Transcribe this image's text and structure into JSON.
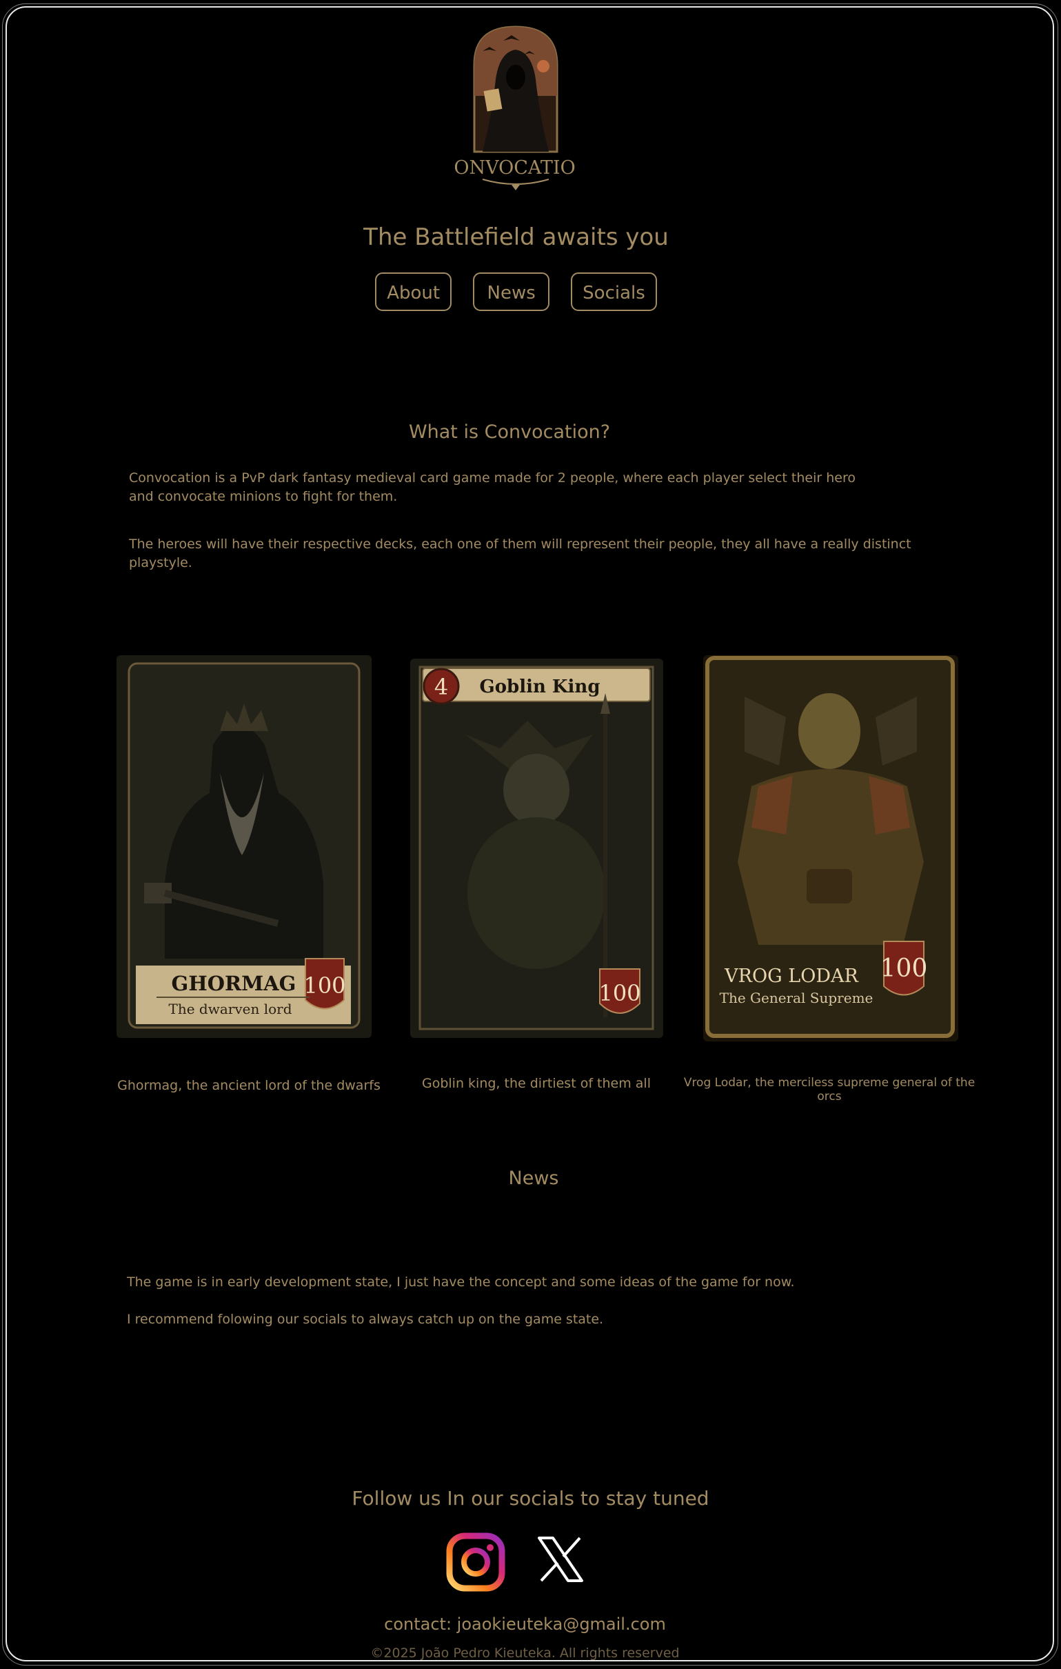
{
  "logo": {
    "name": "convocation-logo",
    "text": "CONVOCATION"
  },
  "hero": {
    "tagline": "The Battlefield awaits you"
  },
  "nav": {
    "about": "About",
    "news": "News",
    "socials": "Socials"
  },
  "about": {
    "title": "What is Convocation?",
    "p1": "Convocation is a PvP dark fantasy medieval card game made for 2 people, where each player select their hero and convocate minions to fight for them.",
    "p2": "The heroes will have their respective decks, each one of them will represent their people, they all have a really distinct playstyle."
  },
  "cards": [
    {
      "name": "GHORMAG",
      "subtitle": "The dwarven lord",
      "value": "100",
      "caption": "Ghormag, the ancient lord of the dwarfs"
    },
    {
      "name": "Goblin King",
      "cost": "4",
      "value": "100",
      "caption": "Goblin king, the dirtiest of them all"
    },
    {
      "name": "VROG LODAR",
      "subtitle": "The General Supreme",
      "value": "100",
      "caption": "Vrog Lodar, the merciless supreme general of the orcs"
    }
  ],
  "news": {
    "title": "News",
    "p1": "The game is in early development state, I just have the concept and some ideas of the game for now.",
    "p2": "I recommend folowing our socials to always catch up on the game state."
  },
  "footer": {
    "title": "Follow us In our socials to stay tuned",
    "contact": "contact: joaokieuteka@gmail.com",
    "copyright": "©2025 João Pedro Kieuteka. All rights reserved"
  },
  "colors": {
    "accent": "#a38b62",
    "background": "#000000",
    "frame": "#e8e8e8"
  },
  "icons": [
    "instagram-icon",
    "x-icon"
  ]
}
